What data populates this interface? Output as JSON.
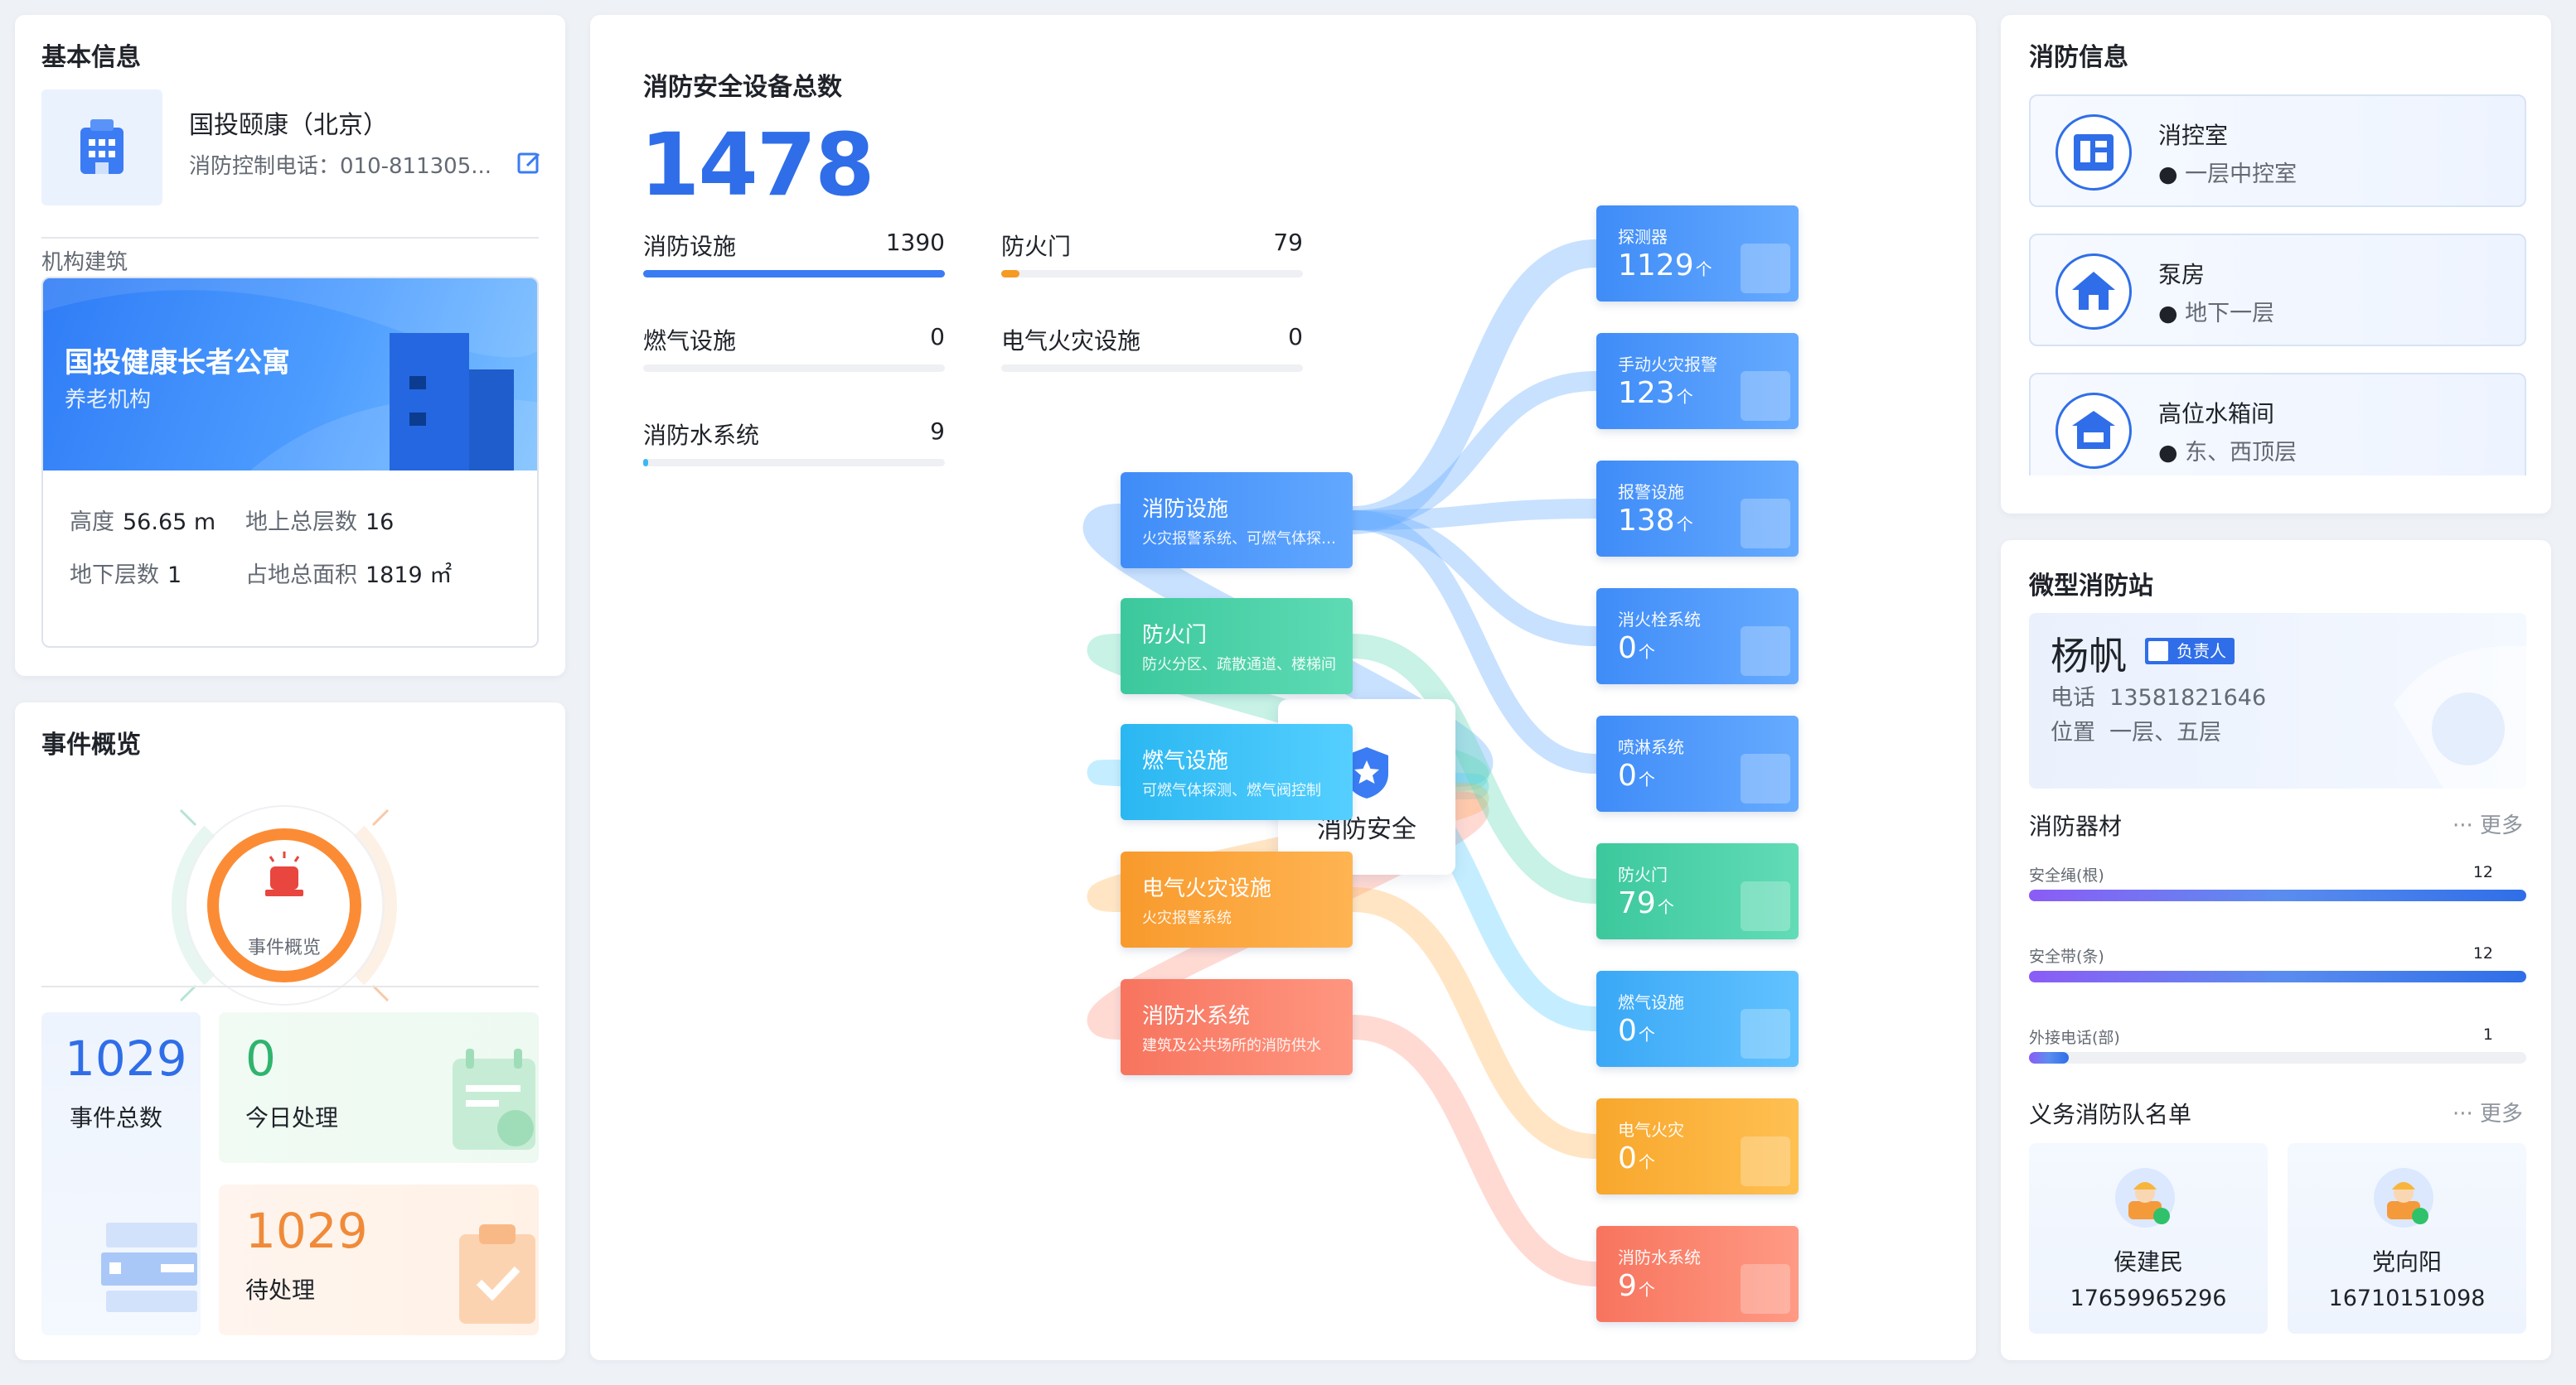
{
  "basic": {
    "title": "基本信息",
    "org_name": "国投颐康（北京）",
    "org_phone": "消防控制电话：010-811305...",
    "section_label": "机构建筑",
    "building_name": "国投健康长者公寓",
    "building_type": "养老机构",
    "height_label": "高度",
    "height_value": "56.65 m",
    "floors_above_label": "地上总层数",
    "floors_above_value": "16",
    "floors_below_label": "地下层数",
    "floors_below_value": "1",
    "area_label": "占地总面积",
    "area_value": "1819 ㎡"
  },
  "events": {
    "title": "事件概览",
    "ring_label": "事件概览",
    "total_value": "1029",
    "total_label": "事件总数",
    "today_value": "0",
    "today_label": "今日处理",
    "pending_value": "1029",
    "pending_label": "待处理"
  },
  "center": {
    "total_label": "消防安全设备总数",
    "total_value": "1478",
    "bars": [
      {
        "name": "消防设施",
        "value": "1390",
        "ratio": 1.0,
        "color": "#3b7cf4"
      },
      {
        "name": "防火门",
        "value": "79",
        "ratio": 0.06,
        "color": "#f59a23"
      },
      {
        "name": "燃气设施",
        "value": "0",
        "ratio": 0,
        "color": "#3b7cf4"
      },
      {
        "name": "电气火灾设施",
        "value": "0",
        "ratio": 0,
        "color": "#3b7cf4"
      },
      {
        "name": "消防水系统",
        "value": "9",
        "ratio": 0.01,
        "color": "#3bb8f4"
      }
    ],
    "root_label": "消防安全",
    "mid_nodes": [
      {
        "title": "消防设施",
        "sub": "火灾报警系统、可燃气体探测系统",
        "c1": "#3f8cf8",
        "c2": "#62a8ff"
      },
      {
        "title": "防火门",
        "sub": "防火分区、疏散通道、楼梯间",
        "c1": "#3cc89c",
        "c2": "#5edbb4"
      },
      {
        "title": "燃气设施",
        "sub": "可燃气体探测、燃气阀控制",
        "c1": "#2ab7f1",
        "c2": "#55cfff"
      },
      {
        "title": "电气火灾设施",
        "sub": "火灾报警系统",
        "c1": "#f89a2c",
        "c2": "#ffb452"
      },
      {
        "title": "消防水系统",
        "sub": "建筑及公共场所的消防供水",
        "c1": "#f7745e",
        "c2": "#ff9680"
      }
    ],
    "unit": "个",
    "leaf_nodes": [
      {
        "title": "探测器",
        "value": "1129",
        "c1": "#3f8cf8",
        "c2": "#66abff"
      },
      {
        "title": "手动火灾报警",
        "value": "123",
        "c1": "#3f8cf8",
        "c2": "#66abff"
      },
      {
        "title": "报警设施",
        "value": "138",
        "c1": "#3f8cf8",
        "c2": "#66abff"
      },
      {
        "title": "消火栓系统",
        "value": "0",
        "c1": "#3f8cf8",
        "c2": "#66abff"
      },
      {
        "title": "喷淋系统",
        "value": "0",
        "c1": "#3f8cf8",
        "c2": "#66abff"
      },
      {
        "title": "防火门",
        "value": "79",
        "c1": "#3cc89c",
        "c2": "#62dcb6"
      },
      {
        "title": "燃气设施",
        "value": "0",
        "c1": "#3aa8f6",
        "c2": "#62c2ff"
      },
      {
        "title": "电气火灾",
        "value": "0",
        "c1": "#f8a72c",
        "c2": "#ffc052"
      },
      {
        "title": "消防水系统",
        "value": "9",
        "c1": "#f7745e",
        "c2": "#ff9a84"
      }
    ]
  },
  "fire_info": {
    "title": "消防信息",
    "items": [
      {
        "name": "消控室",
        "loc": "一层中控室"
      },
      {
        "name": "泵房",
        "loc": "地下一层"
      },
      {
        "name": "高位水箱间",
        "loc": "东、西顶层"
      }
    ]
  },
  "station": {
    "title": "微型消防站",
    "chief_name": "杨帆",
    "chief_badge": "负责人",
    "phone_label": "电话",
    "phone_value": "13581821646",
    "loc_label": "位置",
    "loc_value": "一层、五层",
    "equip_title": "消防器材",
    "more_label": "··· 更多",
    "equip": [
      {
        "name": "安全绳(根)",
        "value": "12",
        "ratio": 1.0
      },
      {
        "name": "安全带(条)",
        "value": "12",
        "ratio": 1.0
      },
      {
        "name": "外接电话(部)",
        "value": "1",
        "ratio": 0.08
      }
    ],
    "vol_title": "义务消防队名单",
    "volunteers": [
      {
        "name": "侯建民",
        "phone": "17659965296"
      },
      {
        "name": "党向阳",
        "phone": "16710151098"
      }
    ]
  }
}
